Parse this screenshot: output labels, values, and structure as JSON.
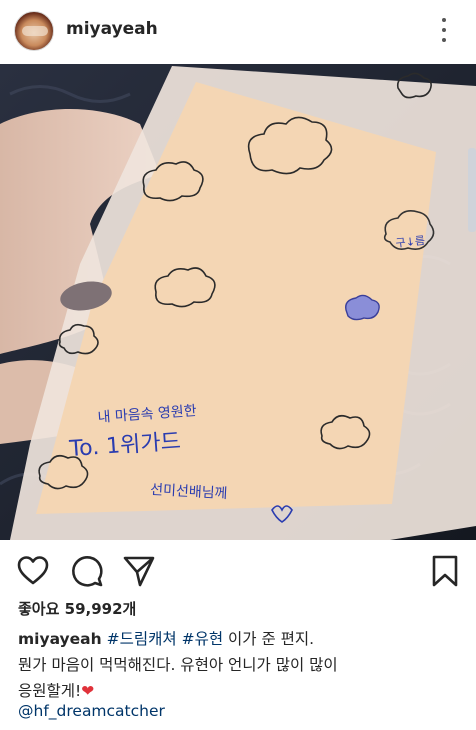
{
  "post": {
    "username": "miyayeah",
    "likes_label": "좋아요",
    "likes_count": "59,992개",
    "caption": {
      "username": "miyayeah",
      "tag1": "#드림캐쳐",
      "tag2": "#유현",
      "line1_rest": "이가 준 편지.",
      "line2": "뭔가 마음이 먹먹해진다. 유현아 언니가 많이 많이",
      "line3": "응원할게!",
      "heart": "❤"
    },
    "mention": "@hf_dreamcatcher"
  },
  "letter": {
    "line1": "내 마음속 영원한",
    "line2": "To. 1위가드",
    "line3": "선미선배님께",
    "cloud_text": "구↓름"
  },
  "icons": [
    "more-icon",
    "heart-icon",
    "comment-icon",
    "share-icon",
    "bookmark-icon"
  ],
  "colors": {
    "text": "#262626",
    "link": "#003569",
    "heart": "#e0323a",
    "paper": "#f4d6b4",
    "background": "#1f2533"
  }
}
